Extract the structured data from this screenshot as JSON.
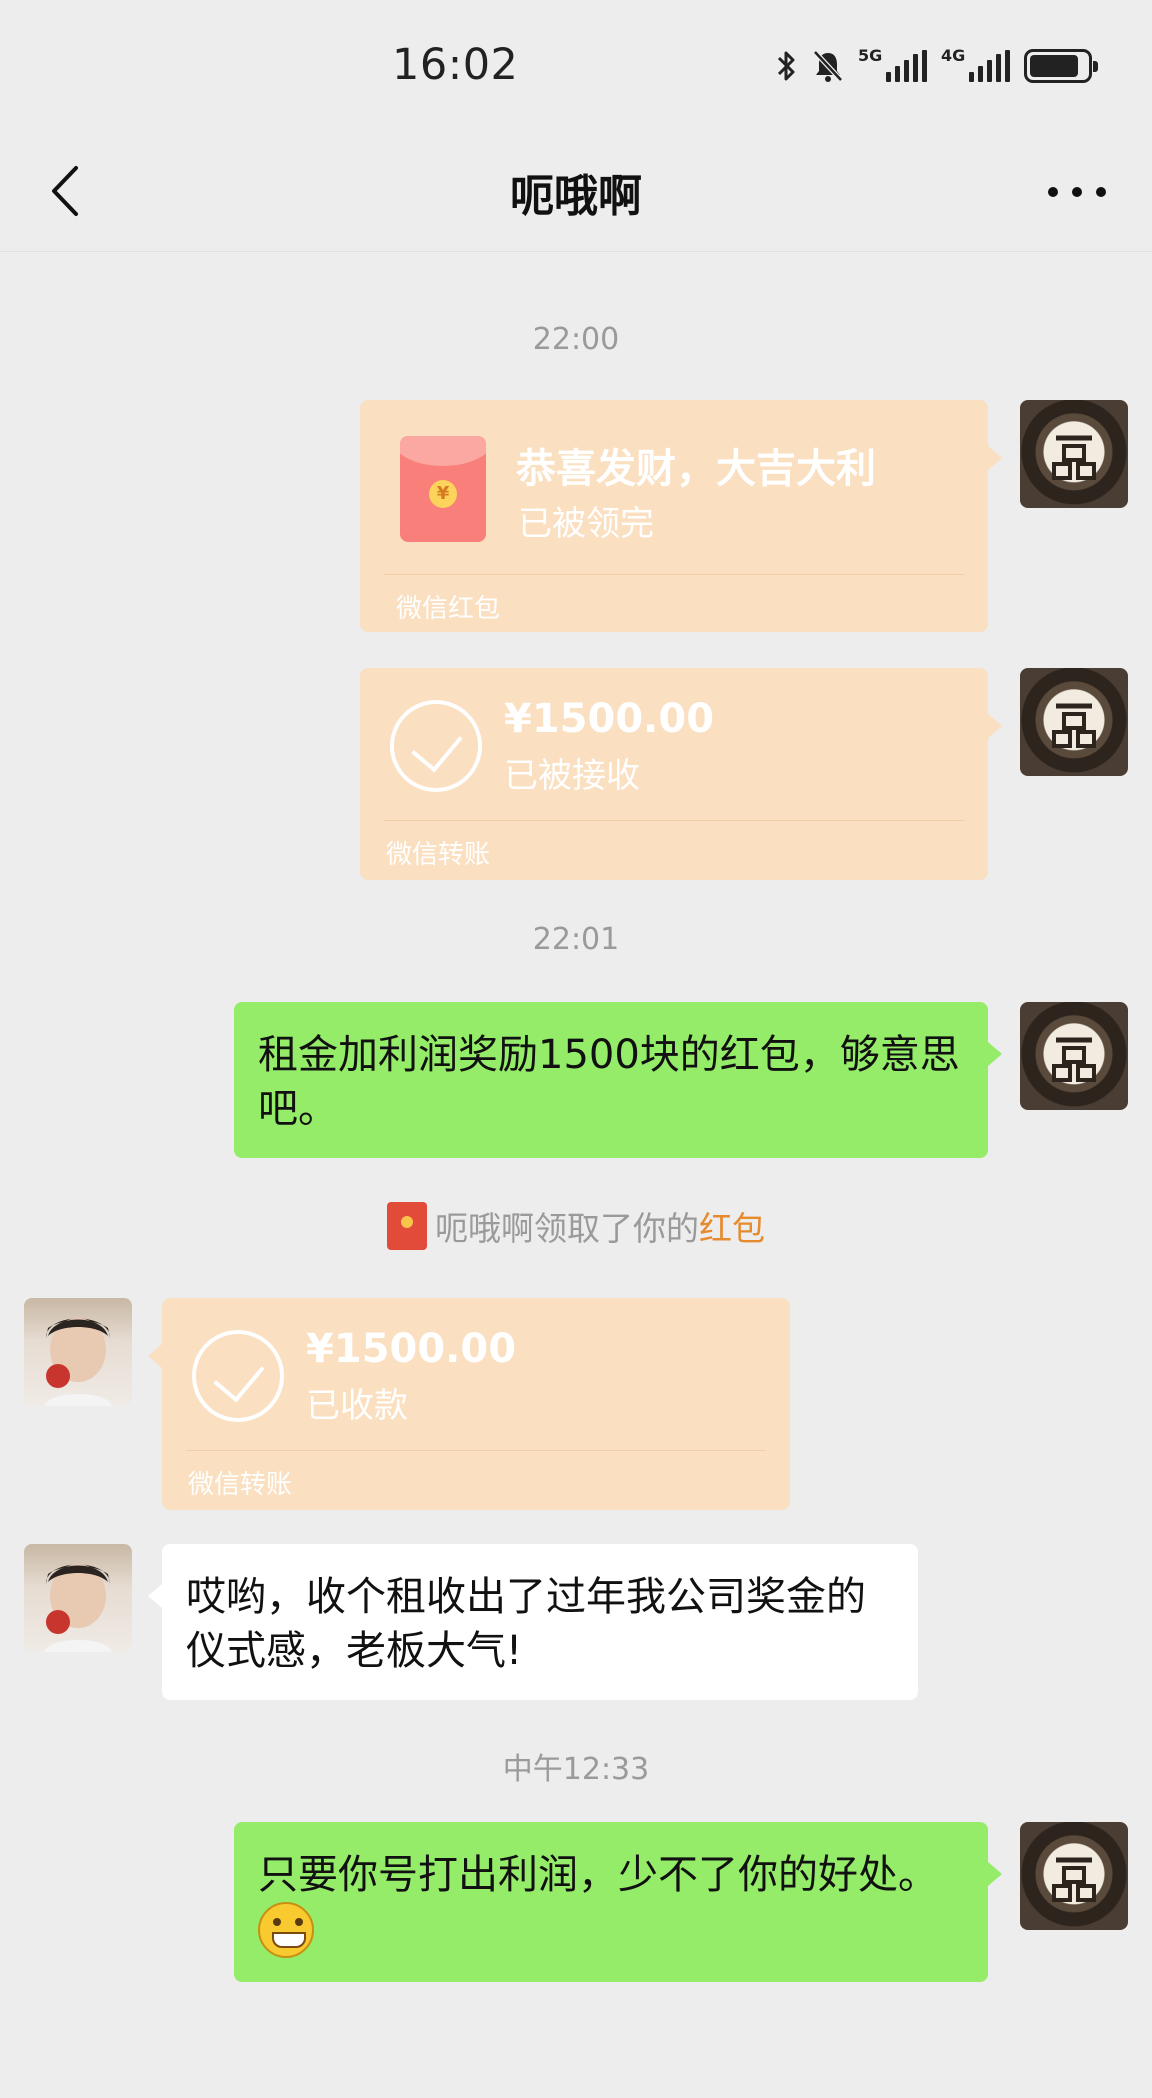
{
  "status_bar": {
    "time": "16:02",
    "icons": [
      "bluetooth-icon",
      "mute-icon",
      "signal-5g-icon",
      "signal-4g-icon",
      "battery-icon"
    ],
    "net1": "5G",
    "net2": "4G",
    "battery_level": 0.85
  },
  "nav": {
    "title": "呃哦啊"
  },
  "colors": {
    "background": "#ededed",
    "transfer_card": "#fadfc1",
    "bubble_self": "#95ec69",
    "bubble_other": "#ffffff",
    "link": "#e68a2e"
  },
  "messages": {
    "time_1": "22:00",
    "red_packet": {
      "title": "恭喜发财，大吉大利",
      "status": "已被领完",
      "footer": "微信红包",
      "coin": "¥"
    },
    "transfer_1": {
      "amount": "¥1500.00",
      "status": "已被接收",
      "footer": "微信转账"
    },
    "time_2": "22:01",
    "text_1": "租金加利润奖励1500块的红包，够意思吧。",
    "notice": {
      "prefix": "呃哦啊领取了你的",
      "link": "红包"
    },
    "transfer_2": {
      "amount": "¥1500.00",
      "status": "已收款",
      "footer": "微信转账"
    },
    "text_2": "哎哟，收个租收出了过年我公司奖金的仪式感，老板大气!",
    "time_3": "中午12:33",
    "text_3": "只要你号打出利润，少不了你的好处。"
  }
}
